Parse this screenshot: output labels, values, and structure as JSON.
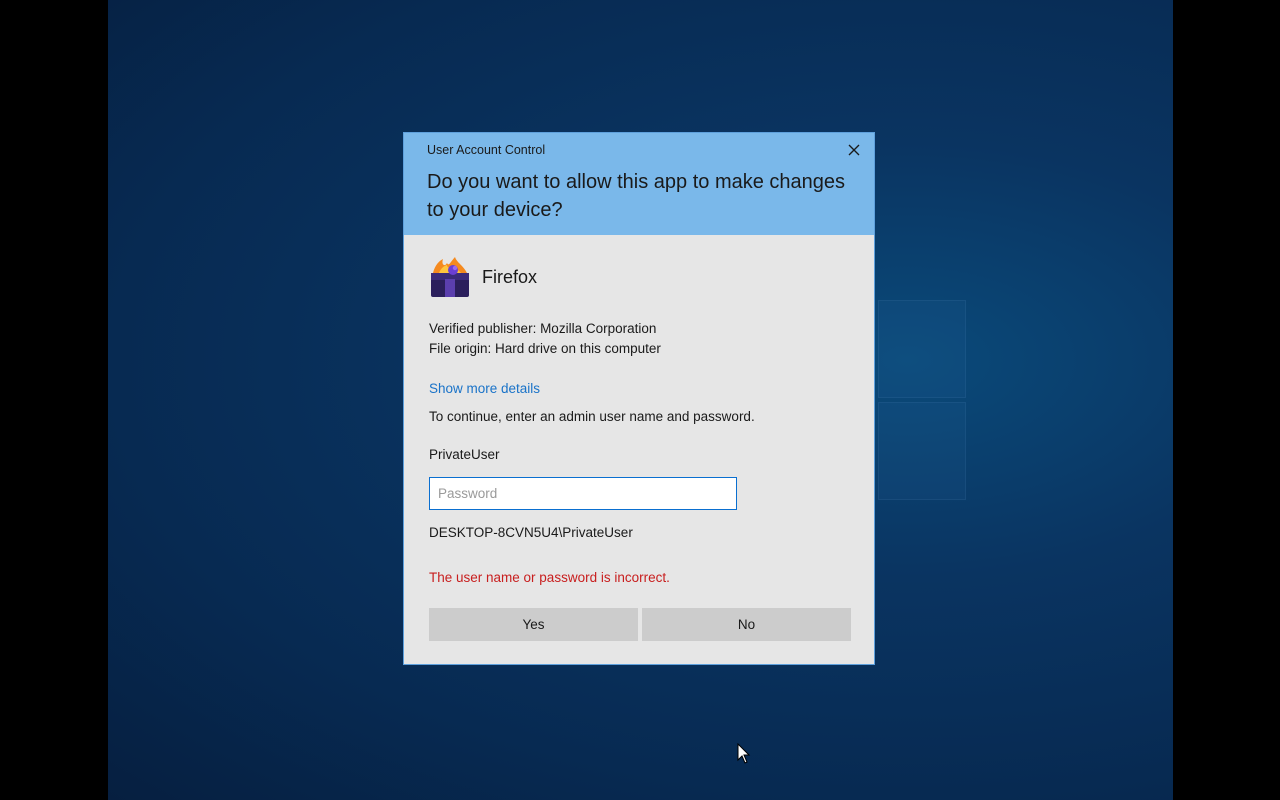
{
  "dialog": {
    "window_title": "User Account Control",
    "question": "Do you want to allow this app to make changes to your device?",
    "app_name": "Firefox",
    "publisher_line": "Verified publisher: Mozilla Corporation",
    "origin_line": "File origin: Hard drive on this computer",
    "details_link": "Show more details",
    "instruction": "To continue, enter an admin user name and password.",
    "username": "PrivateUser",
    "password_value": "",
    "password_placeholder": "Password",
    "domain_user": "DESKTOP-8CVN5U4\\PrivateUser",
    "error_message": "The user name or password is incorrect.",
    "yes_label": "Yes",
    "no_label": "No"
  },
  "icons": {
    "close": "close-icon",
    "app": "firefox-app-icon",
    "windows_logo": "windows-logo",
    "cursor": "mouse-pointer-icon"
  },
  "colors": {
    "header_bg": "#7ab8ea",
    "dialog_bg": "#e6e6e6",
    "link": "#1a73c8",
    "error": "#c81e1e",
    "button_bg": "#cccccc",
    "input_border": "#0a6fd0"
  }
}
